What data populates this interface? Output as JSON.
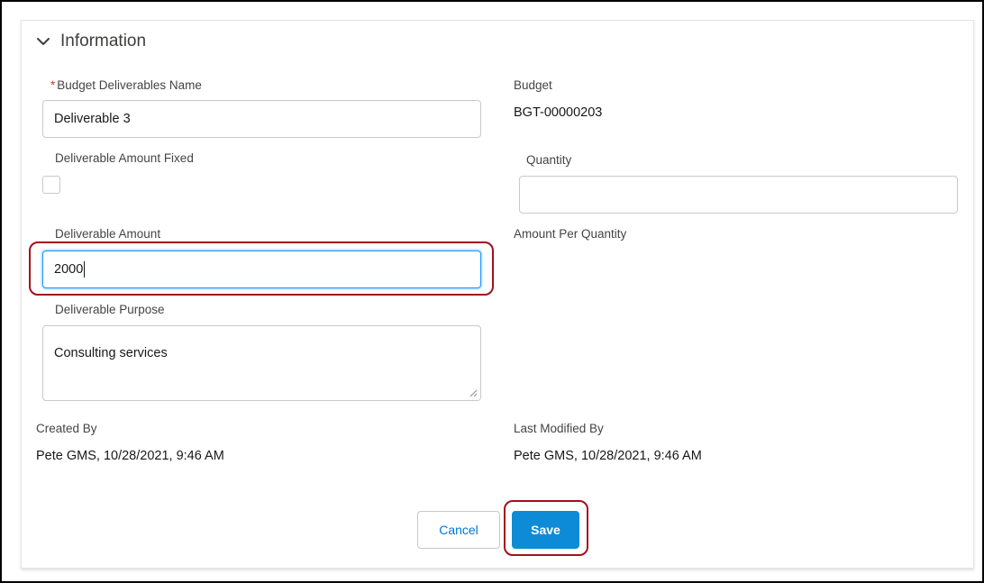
{
  "section": {
    "title": "Information",
    "chevron_icon": "chevron-down-icon"
  },
  "fields": {
    "budget_deliverables_name": {
      "label": "Budget Deliverables Name",
      "required_marker": "*",
      "value": "Deliverable 3"
    },
    "budget": {
      "label": "Budget",
      "value": "BGT-00000203"
    },
    "deliverable_amount_fixed": {
      "label": "Deliverable Amount Fixed",
      "checked": false
    },
    "quantity": {
      "label": "Quantity",
      "value": ""
    },
    "deliverable_amount": {
      "label": "Deliverable Amount",
      "value": "2000"
    },
    "amount_per_quantity": {
      "label": "Amount Per Quantity",
      "value": ""
    },
    "deliverable_purpose": {
      "label": "Deliverable Purpose",
      "value": "Consulting services"
    },
    "created_by": {
      "label": "Created By",
      "value": "Pete GMS, 10/28/2021, 9:46 AM"
    },
    "last_modified_by": {
      "label": "Last Modified By",
      "value": "Pete GMS, 10/28/2021, 9:46 AM"
    }
  },
  "actions": {
    "cancel_label": "Cancel",
    "save_label": "Save"
  },
  "colors": {
    "accent": "#0e8bd6",
    "link": "#0176d3",
    "focus_border": "#1b96ff",
    "annotation": "#a30f1d",
    "required": "#c23934"
  }
}
